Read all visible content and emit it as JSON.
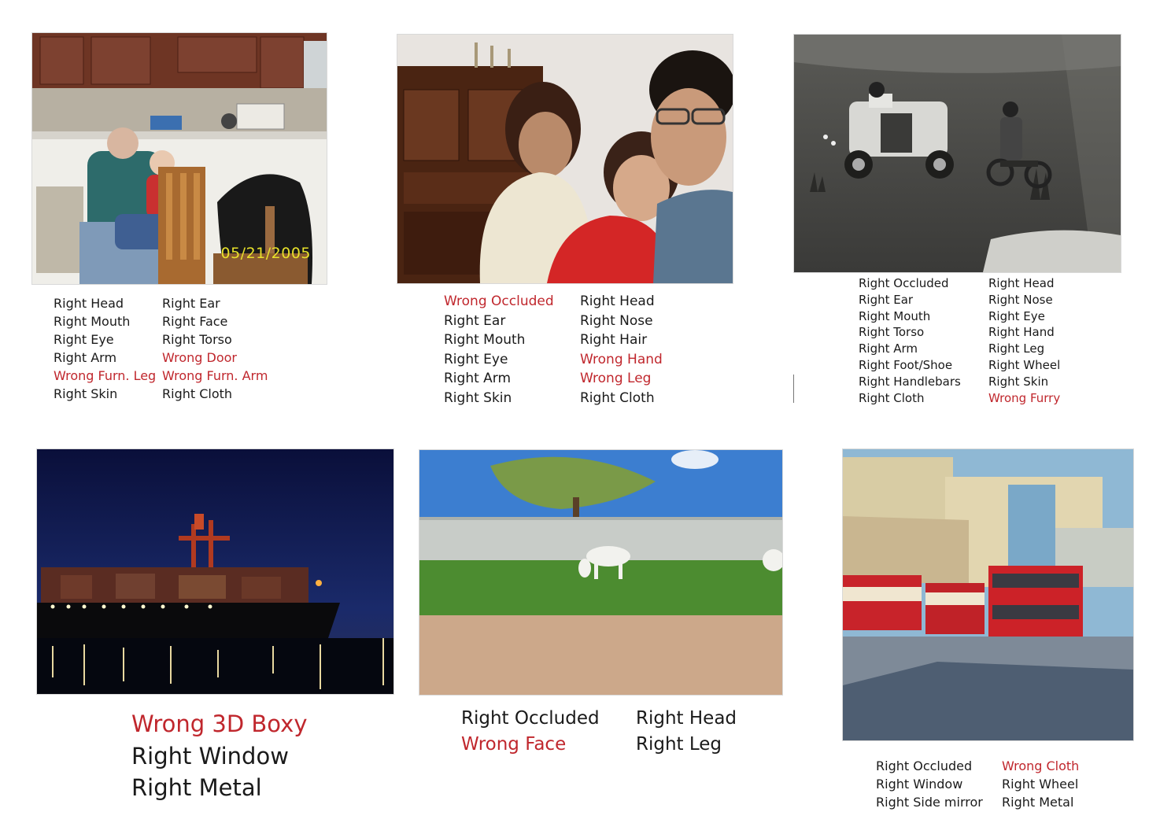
{
  "panels": [
    {
      "stamp": "05/21/2005",
      "columns": [
        [
          {
            "text": "Right Head",
            "status": "right"
          },
          {
            "text": "Right Mouth",
            "status": "right"
          },
          {
            "text": "Right Eye",
            "status": "right"
          },
          {
            "text": "Right Arm",
            "status": "right"
          },
          {
            "text": "Wrong Furn. Leg",
            "status": "wrong"
          },
          {
            "text": "Right Skin",
            "status": "right"
          }
        ],
        [
          {
            "text": "Right Ear",
            "status": "right"
          },
          {
            "text": "Right Face",
            "status": "right"
          },
          {
            "text": "Right Torso",
            "status": "right"
          },
          {
            "text": "Wrong Door",
            "status": "wrong"
          },
          {
            "text": "Wrong Furn. Arm",
            "status": "wrong"
          },
          {
            "text": "Right Cloth",
            "status": "right"
          }
        ]
      ]
    },
    {
      "columns": [
        [
          {
            "text": "Wrong Occluded",
            "status": "wrong"
          },
          {
            "text": "Right Ear",
            "status": "right"
          },
          {
            "text": "Right Mouth",
            "status": "right"
          },
          {
            "text": "Right Eye",
            "status": "right"
          },
          {
            "text": "Right Arm",
            "status": "right"
          },
          {
            "text": "Right Skin",
            "status": "right"
          }
        ],
        [
          {
            "text": "Right Head",
            "status": "right"
          },
          {
            "text": "Right Nose",
            "status": "right"
          },
          {
            "text": "Right Hair",
            "status": "right"
          },
          {
            "text": "Wrong Hand",
            "status": "wrong"
          },
          {
            "text": "Wrong Leg",
            "status": "wrong"
          },
          {
            "text": "Right Cloth",
            "status": "right"
          }
        ]
      ]
    },
    {
      "columns": [
        [
          {
            "text": "Right Occluded",
            "status": "right"
          },
          {
            "text": "Right Ear",
            "status": "right"
          },
          {
            "text": "Right Mouth",
            "status": "right"
          },
          {
            "text": "Right Torso",
            "status": "right"
          },
          {
            "text": "Right Arm",
            "status": "right"
          },
          {
            "text": "Right Foot/Shoe",
            "status": "right"
          },
          {
            "text": "Right Handlebars",
            "status": "right"
          },
          {
            "text": "Right Cloth",
            "status": "right"
          }
        ],
        [
          {
            "text": "Right Head",
            "status": "right"
          },
          {
            "text": "Right Nose",
            "status": "right"
          },
          {
            "text": "Right Eye",
            "status": "right"
          },
          {
            "text": "Right Hand",
            "status": "right"
          },
          {
            "text": "Right Leg",
            "status": "right"
          },
          {
            "text": "Right Wheel",
            "status": "right"
          },
          {
            "text": "Right Skin",
            "status": "right"
          },
          {
            "text": "Wrong Furry",
            "status": "wrong"
          }
        ]
      ]
    },
    {
      "columns": [
        [
          {
            "text": "Wrong 3D Boxy",
            "status": "wrong"
          },
          {
            "text": "Right Window",
            "status": "right"
          },
          {
            "text": "Right Metal",
            "status": "right"
          }
        ]
      ]
    },
    {
      "columns": [
        [
          {
            "text": "Right Occluded",
            "status": "right"
          },
          {
            "text": "Wrong Face",
            "status": "wrong"
          }
        ],
        [
          {
            "text": "Right Head",
            "status": "right"
          },
          {
            "text": "Right Leg",
            "status": "right"
          }
        ]
      ]
    },
    {
      "columns": [
        [
          {
            "text": "Right Occluded",
            "status": "right"
          },
          {
            "text": "Right Window",
            "status": "right"
          },
          {
            "text": "Right Side mirror",
            "status": "right"
          }
        ],
        [
          {
            "text": "Wrong Cloth",
            "status": "wrong"
          },
          {
            "text": "Right Wheel",
            "status": "right"
          },
          {
            "text": "Right Metal",
            "status": "right"
          }
        ]
      ]
    }
  ],
  "colors": {
    "right": "#1a1a1a",
    "wrong": "#c0272d",
    "date_stamp": "#e8e12a"
  }
}
